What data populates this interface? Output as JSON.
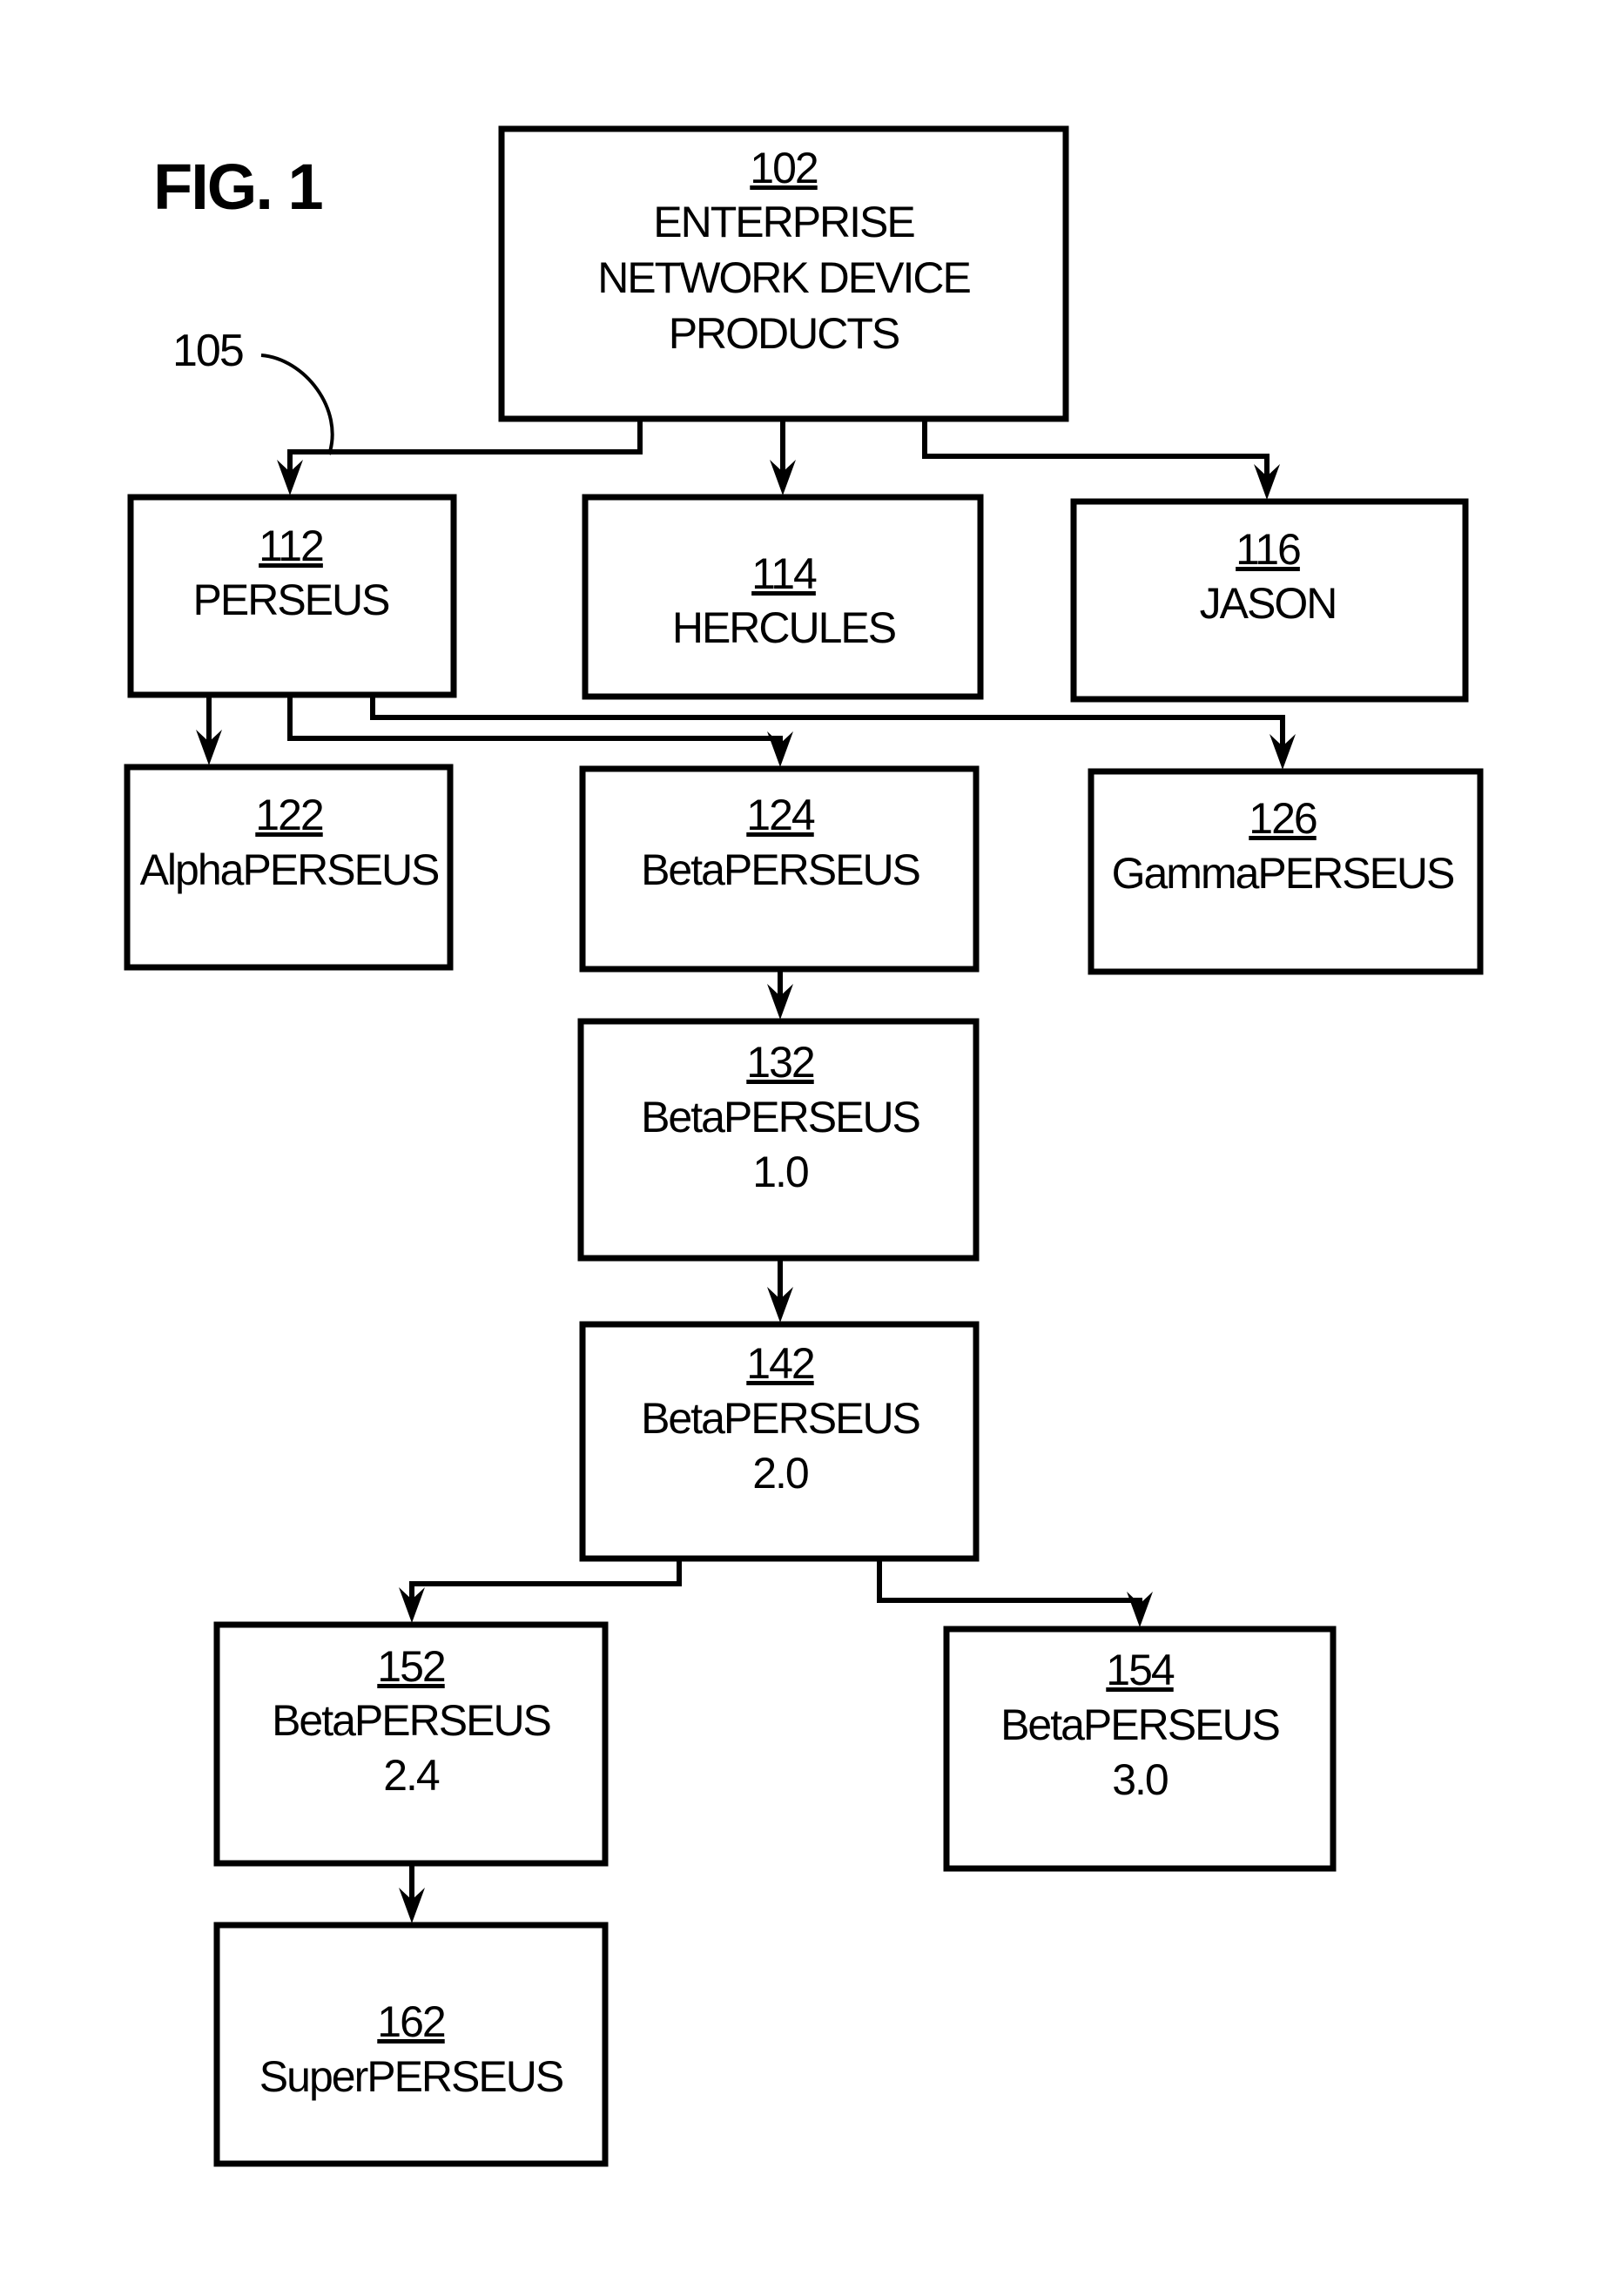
{
  "figure": {
    "title": "FIG. 1",
    "pointer_label": "105"
  },
  "nodes": {
    "n102": {
      "ref": "102",
      "lines": [
        "ENTERPRISE",
        "NETWORK DEVICE",
        "PRODUCTS"
      ]
    },
    "n112": {
      "ref": "112",
      "lines": [
        "PERSEUS"
      ]
    },
    "n114": {
      "ref": "114",
      "lines": [
        "HERCULES"
      ]
    },
    "n116": {
      "ref": "116",
      "lines": [
        "JASON"
      ]
    },
    "n122": {
      "ref": "122",
      "lines": [
        "AlphaPERSEUS"
      ]
    },
    "n124": {
      "ref": "124",
      "lines": [
        "BetaPERSEUS"
      ]
    },
    "n126": {
      "ref": "126",
      "lines": [
        "GammaPERSEUS"
      ]
    },
    "n132": {
      "ref": "132",
      "lines": [
        "BetaPERSEUS",
        "1.0"
      ]
    },
    "n142": {
      "ref": "142",
      "lines": [
        "BetaPERSEUS",
        "2.0"
      ]
    },
    "n152": {
      "ref": "152",
      "lines": [
        "BetaPERSEUS",
        "2.4"
      ]
    },
    "n154": {
      "ref": "154",
      "lines": [
        "BetaPERSEUS",
        "3.0"
      ]
    },
    "n162": {
      "ref": "162",
      "lines": [
        "SuperPERSEUS"
      ]
    }
  },
  "edges": [
    {
      "from": "102",
      "to": "112"
    },
    {
      "from": "102",
      "to": "114"
    },
    {
      "from": "102",
      "to": "116"
    },
    {
      "from": "112",
      "to": "122"
    },
    {
      "from": "112",
      "to": "124"
    },
    {
      "from": "112",
      "to": "126"
    },
    {
      "from": "124",
      "to": "132"
    },
    {
      "from": "132",
      "to": "142"
    },
    {
      "from": "142",
      "to": "152"
    },
    {
      "from": "142",
      "to": "154"
    },
    {
      "from": "152",
      "to": "162"
    }
  ]
}
